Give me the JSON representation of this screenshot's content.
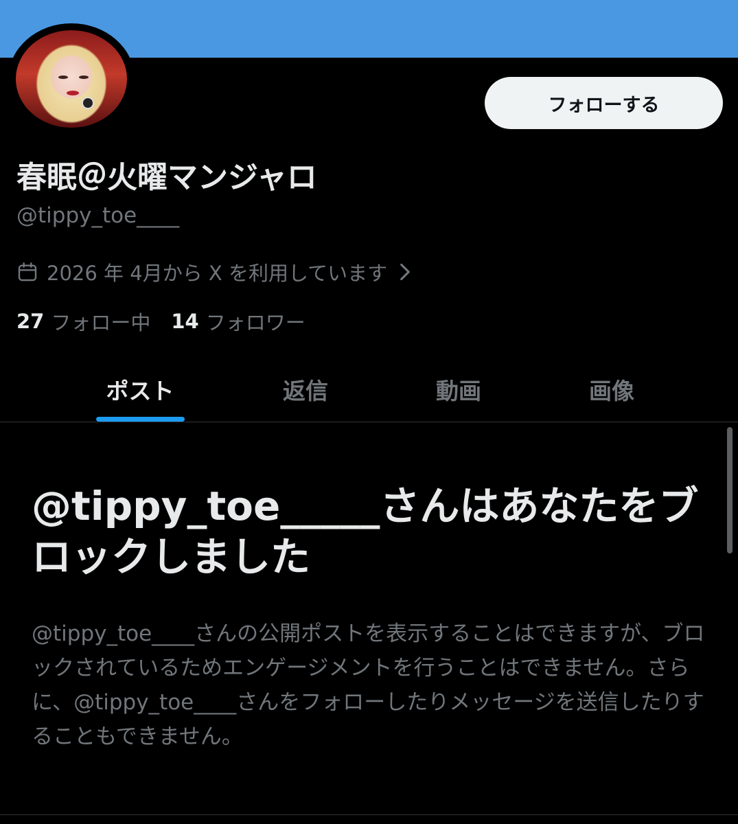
{
  "profile": {
    "display_name": "春眠＠火曜マンジャロ",
    "handle": "@tippy_toe____",
    "joined": "2026 年 4月から X を利用しています",
    "following_count": "27",
    "following_label": "フォロー中",
    "followers_count": "14",
    "followers_label": "フォロワー",
    "follow_button": "フォローする"
  },
  "tabs": [
    {
      "label": "ポスト",
      "active": true
    },
    {
      "label": "返信",
      "active": false
    },
    {
      "label": "動画",
      "active": false
    },
    {
      "label": "画像",
      "active": false
    }
  ],
  "blocked": {
    "title": "@tippy_toe_____さんはあなたをブロックしました",
    "body": "@tippy_toe____さんの公開ポストを表示することはできますが、ブロックされているためエンゲージメントを行うことはできません。さらに、@tippy_toe____さんをフォローしたりメッセージを送信したりすることもできません。"
  },
  "colors": {
    "banner": "#4a98e2",
    "accent": "#1d9bf0",
    "background": "#000000",
    "muted_text": "#71767b"
  },
  "icons": {
    "calendar": "calendar-icon",
    "chevron": "chevron-right-icon"
  }
}
